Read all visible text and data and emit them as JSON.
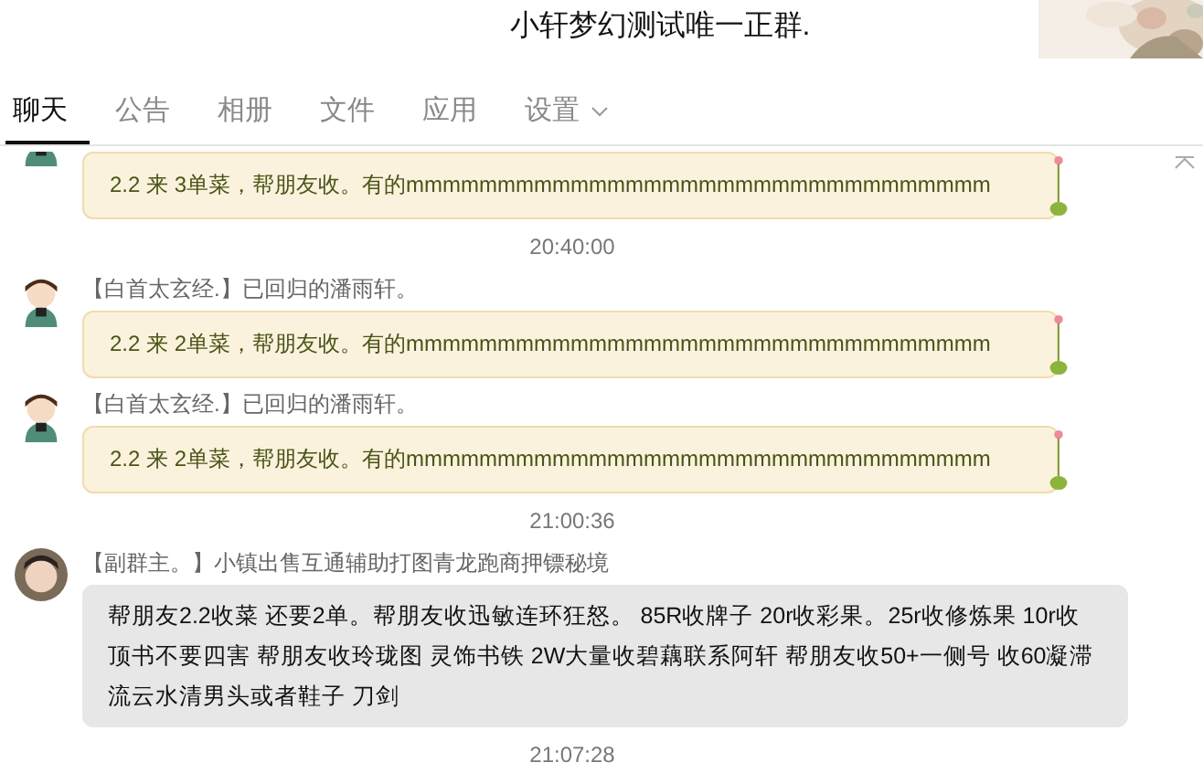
{
  "window": {
    "title": "小轩梦幻测试唯一正群."
  },
  "tabs": [
    {
      "label": "聊天",
      "selected": true,
      "dropdown": false
    },
    {
      "label": "公告",
      "selected": false,
      "dropdown": false
    },
    {
      "label": "相册",
      "selected": false,
      "dropdown": false
    },
    {
      "label": "文件",
      "selected": false,
      "dropdown": false
    },
    {
      "label": "应用",
      "selected": false,
      "dropdown": false
    },
    {
      "label": "设置",
      "selected": false,
      "dropdown": true
    }
  ],
  "messages": [
    {
      "kind": "themed_message",
      "clipped": true,
      "text": "2.2  来 3单菜，帮朋友收。有的mmmmmmmmmmmmmmmmmmmmmmmmmmmmmmmm"
    },
    {
      "kind": "time",
      "text": "20:40:00"
    },
    {
      "kind": "themed_message",
      "clipped": false,
      "sender": "【白首太玄经.】已回归的潘雨轩。",
      "text": "2.2  来 2单菜，帮朋友收。有的mmmmmmmmmmmmmmmmmmmmmmmmmmmmmmmm"
    },
    {
      "kind": "themed_message",
      "clipped": false,
      "sender": "【白首太玄经.】已回归的潘雨轩。",
      "text": "2.2  来 2单菜，帮朋友收。有的mmmmmmmmmmmmmmmmmmmmmmmmmmmmmmmm"
    },
    {
      "kind": "time",
      "text": "21:00:36"
    },
    {
      "kind": "plain_message",
      "clipped": false,
      "sender": "【副群主。】小镇出售互通辅助打图青龙跑商押镖秘境",
      "text": "帮朋友2.2收菜  还要2单。帮朋友收迅敏连环狂怒。 85R收牌子 20r收彩果。25r收修炼果  10r收顶书不要四害  帮朋友收玲珑图 灵饰书铁  2W大量收碧藕联系阿轩  帮朋友收50+一侧号     收60凝滞流云水清男头或者鞋子 刀剑"
    },
    {
      "kind": "time",
      "text": "21:07:28"
    }
  ]
}
